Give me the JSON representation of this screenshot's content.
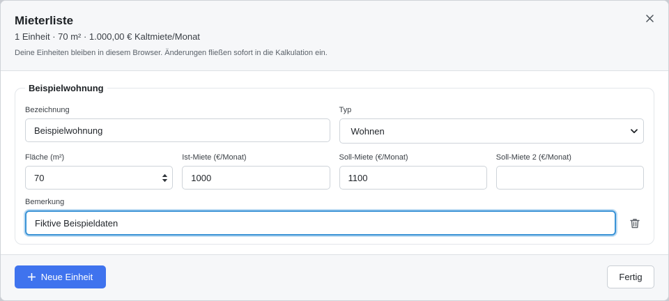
{
  "header": {
    "title": "Mieterliste",
    "summary": "1 Einheit · 70 m² · 1.000,00 € Kaltmiete/Monat",
    "hint": "Deine Einheiten bleiben in diesem Browser. Änderungen fließen sofort in die Kalkulation ein.",
    "close_icon": "close-icon"
  },
  "unit": {
    "legend": "Beispielwohnung",
    "bezeichnung": {
      "label": "Bezeichnung",
      "value": "Beispielwohnung"
    },
    "typ": {
      "label": "Typ",
      "value": "Wohnen"
    },
    "flaeche": {
      "label": "Fläche (m²)",
      "value": "70"
    },
    "ist_miete": {
      "label": "Ist-Miete (€/Monat)",
      "value": "1000"
    },
    "soll_miete": {
      "label": "Soll-Miete (€/Monat)",
      "value": "1100"
    },
    "soll_miete_2": {
      "label": "Soll-Miete 2 (€/Monat)",
      "value": ""
    },
    "bemerkung": {
      "label": "Bemerkung",
      "value": "Fiktive Beispieldaten"
    },
    "delete_icon": "trash-icon"
  },
  "footer": {
    "add_label": "Neue Einheit",
    "done_label": "Fertig"
  },
  "colors": {
    "primary": "#3f73ee",
    "focus": "#3a93d6"
  }
}
